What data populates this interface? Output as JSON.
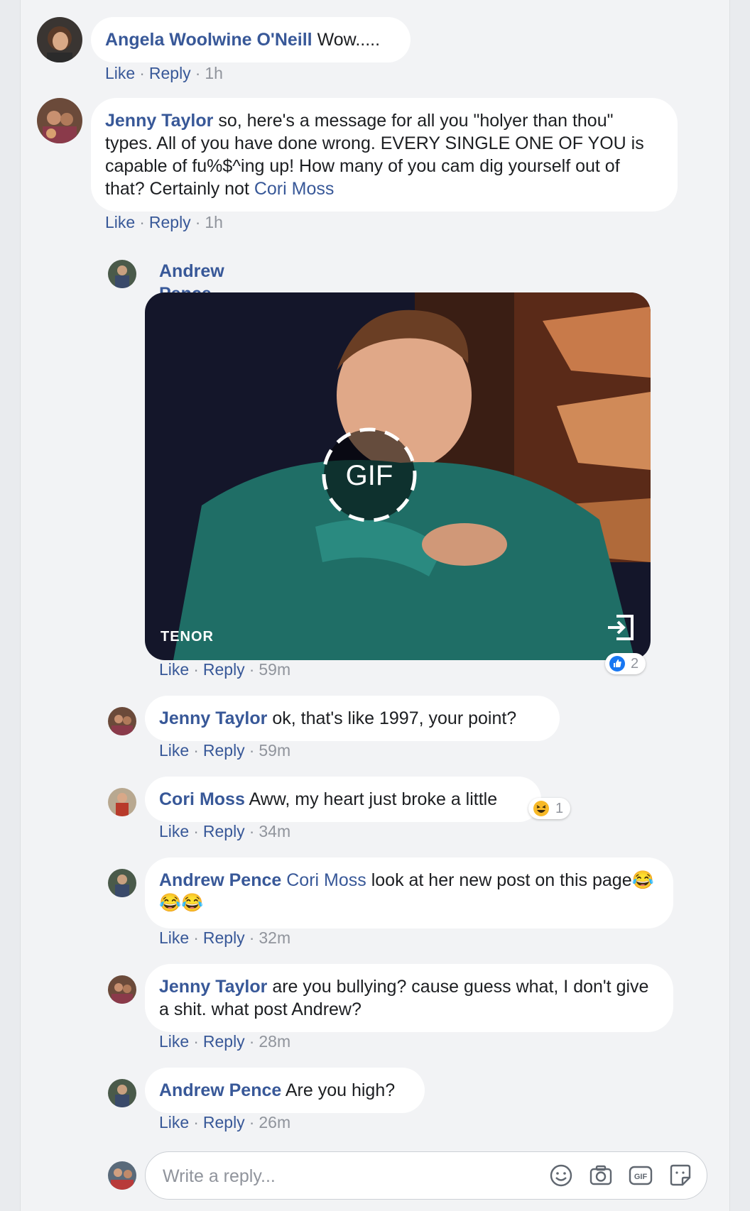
{
  "actions": {
    "like": "Like",
    "reply": "Reply",
    "sep": "·"
  },
  "comments": [
    {
      "author": "Angela Woolwine O'Neill",
      "text": "Wow.....",
      "time": "1h"
    },
    {
      "author": "Jenny Taylor",
      "text_before": "so, here's a message for all you \"holyer than thou\" types. All of you have done wrong. EVERY SINGLE ONE OF YOU is capable of fu%$^ing up! How many of you cam dig yourself out of that? Certainly not ",
      "mention": "Cori Moss",
      "time": "1h"
    }
  ],
  "replies": [
    {
      "author": "Andrew Pence",
      "gif": {
        "badge": "GIF",
        "provider": "TENOR"
      },
      "reaction_count": "2",
      "time": "59m"
    },
    {
      "author": "Jenny Taylor",
      "text": "ok, that's like 1997, your point?",
      "time": "59m"
    },
    {
      "author": "Cori Moss",
      "text": "Aww, my heart just broke a little",
      "reaction_count": "1",
      "time": "34m"
    },
    {
      "author": "Andrew Pence",
      "mention": "Cori Moss",
      "text_after": "look at her new post on this page",
      "emojis": "😂😂😂",
      "time": "32m"
    },
    {
      "author": "Jenny Taylor",
      "text": "are you bullying? cause guess what, I don't give a shit. what post Andrew?",
      "time": "28m"
    },
    {
      "author": "Andrew Pence",
      "text": "Are you high?",
      "time": "26m"
    }
  ],
  "reply_box": {
    "placeholder": "Write a reply..."
  },
  "colors": {
    "link": "#385898",
    "meta": "#90949c",
    "like_blue": "#1877f2",
    "page_bg": "#f2f3f5"
  }
}
